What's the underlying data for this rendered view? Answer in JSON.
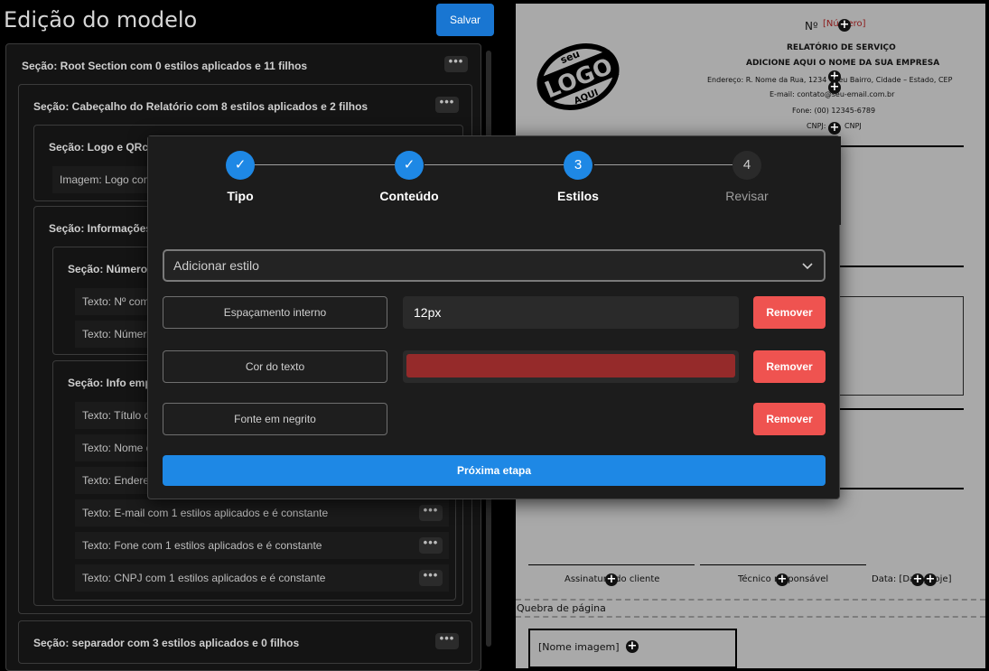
{
  "editor": {
    "title": "Edição do modelo",
    "save_label": "Salvar",
    "root": "Seção: Root Section com 0 estilos aplicados e 11 filhos",
    "header": "Seção: Cabeçalho do Relatório com 8 estilos aplicados e 2 filhos",
    "logo_section": "Seção: Logo e QRcode",
    "logo_image": "Imagem: Logo com",
    "info_section": "Seção: Informações",
    "number_section": "Seção: Número d",
    "text_num": "Texto: Nº com",
    "text_numero": "Texto: Númer",
    "company_section": "Seção: Info empr",
    "text_title": "Texto: Título c",
    "text_name": "Texto: Nome d",
    "text_address": "Texto: Endere",
    "text_email": "Texto: E-mail com 1 estilos aplicados e é constante",
    "text_phone": "Texto: Fone com 1 estilos aplicados e é constante",
    "text_cnpj": "Texto: CNPJ com 1 estilos aplicados e é constante",
    "separator": "Seção: separador com 3 estilos aplicados e 0 filhos",
    "menu_glyph": "•••"
  },
  "preview": {
    "number_label": "Nº",
    "number_value": "[Número]",
    "report_title": "RELATÓRIO DE SERVIÇO",
    "company_name": "ADICIONE AQUI O NOME DA SUA EMPRESA",
    "address": "Endereço: R. Nome da Rua, 1234 - Seu Bairro, Cidade – Estado, CEP",
    "email": "E-mail: contato@seu-email.com.br",
    "phone": "Fone: (00) 12345-6789",
    "cnpj_label": "CNPJ:",
    "cnpj_value": "CNPJ",
    "logo_top": "seu",
    "logo_main": "LOGO",
    "logo_bottom": "AQUI",
    "sign_client": "Assinatura do cliente",
    "sign_tech": "Técnico responsável",
    "date_label": "Data: [Data_hoje]",
    "page_break": "Quebra de página",
    "image_name": "[Nome imagem]",
    "plus_glyph": "+"
  },
  "modal": {
    "steps": [
      {
        "label": "Tipo",
        "marker": "✓",
        "state": "done"
      },
      {
        "label": "Conteúdo",
        "marker": "✓",
        "state": "done"
      },
      {
        "label": "Estilos",
        "marker": "3",
        "state": "active"
      },
      {
        "label": "Revisar",
        "marker": "4",
        "state": "todo"
      }
    ],
    "add_style_placeholder": "Adicionar estilo",
    "styles": [
      {
        "name": "Espaçamento interno",
        "value": "12px"
      },
      {
        "name": "Cor do texto",
        "color": "#952a2a"
      },
      {
        "name": "Fonte em negrito"
      }
    ],
    "remove_label": "Remover",
    "next_label": "Próxima etapa"
  },
  "colors": {
    "primary": "#1e88e5",
    "danger": "#ef5350",
    "preview_number_red": "#8b1a1a"
  }
}
